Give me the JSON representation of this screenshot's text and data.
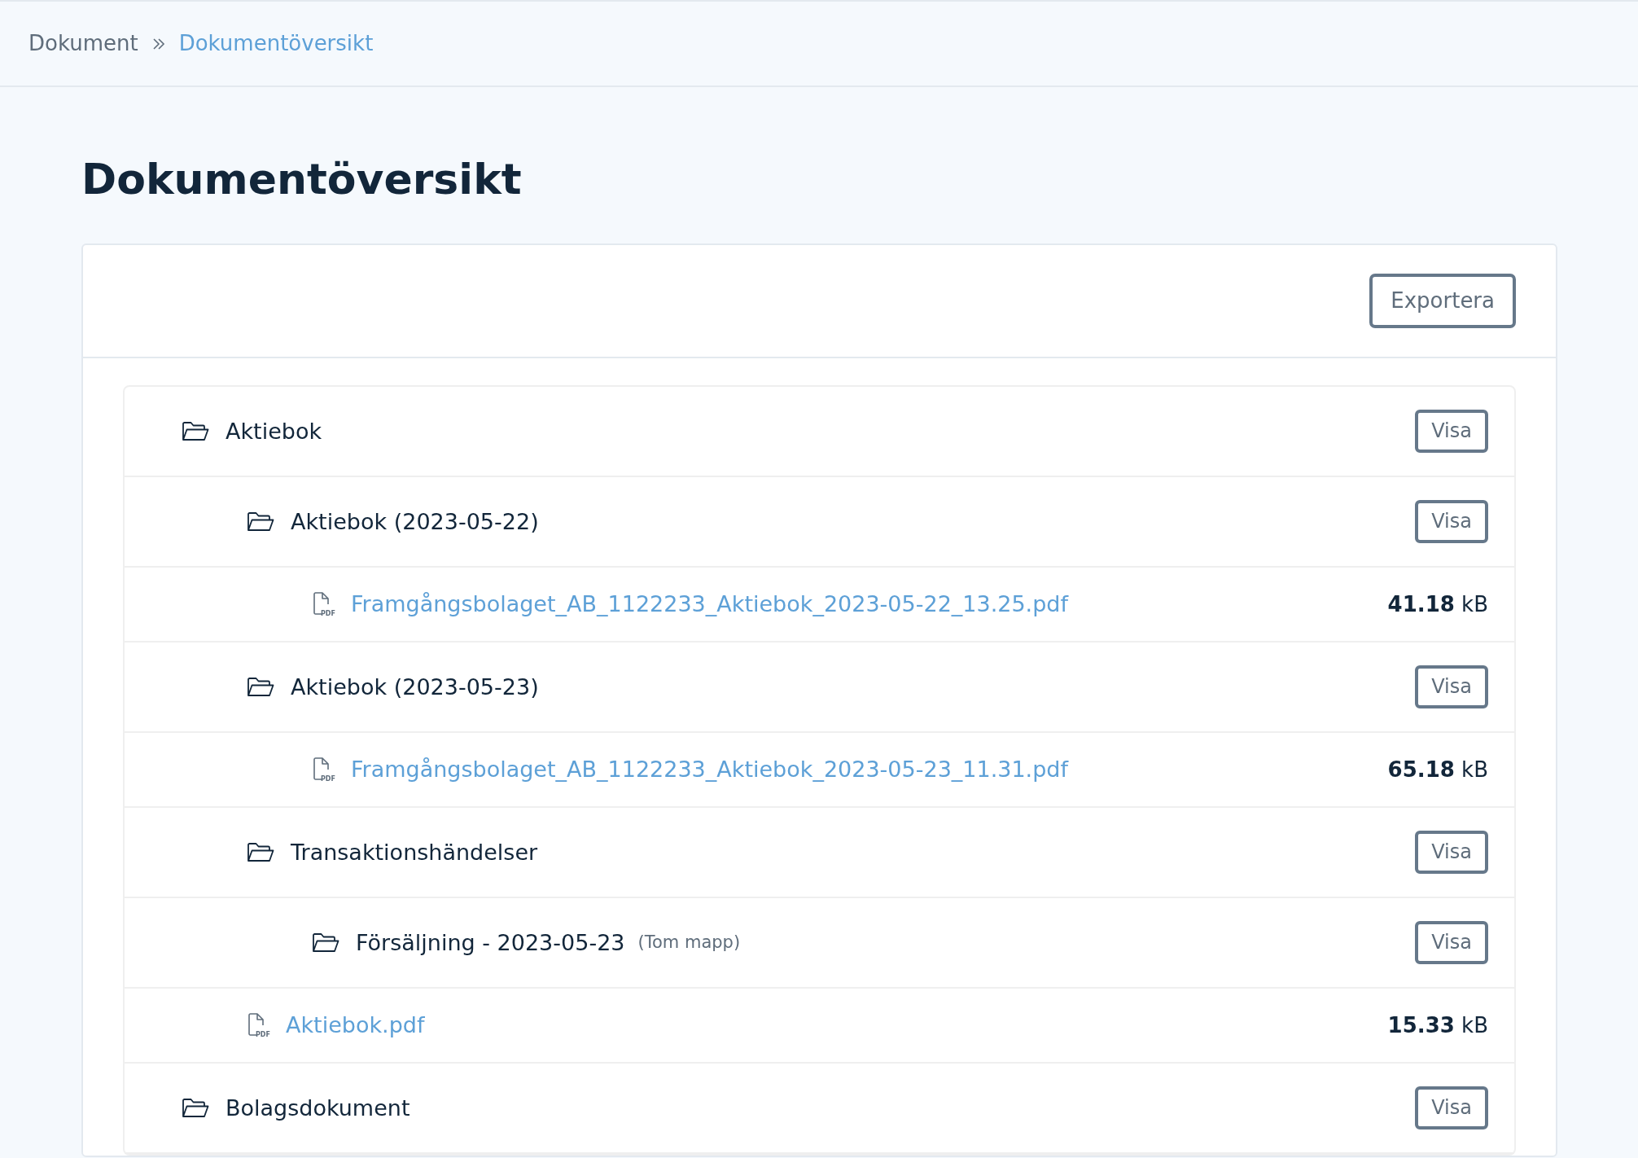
{
  "breadcrumb": [
    {
      "label": "Dokument",
      "selected": false
    },
    {
      "label": "Dokumentöversikt",
      "selected": true
    }
  ],
  "title": "Dokumentöversikt",
  "export_button": "Exportera",
  "tree": [
    {
      "kind": "folder",
      "name": "Aktiebok",
      "action": "Visa",
      "children": [
        {
          "kind": "folder",
          "name": "Aktiebok (2023-05-22)",
          "action": "Visa",
          "children": [
            {
              "kind": "file",
              "icon_label": "PDF",
              "name": "Framgångsbolaget_AB_1122233_Aktiebok_2023-05-22_13.25.pdf",
              "size": "**41.18** kB"
            }
          ]
        },
        {
          "kind": "folder",
          "name": "Aktiebok (2023-05-23)",
          "action": "Visa",
          "children": [
            {
              "kind": "file",
              "icon_label": "PDF",
              "name": "Framgångsbolaget_AB_1122233_Aktiebok_2023-05-23_11.31.pdf",
              "size": "**65.18** kB"
            }
          ]
        },
        {
          "kind": "folder",
          "name": "Transaktionshändelser",
          "action": "Visa",
          "children": [
            {
              "kind": "folder",
              "name": "Försäljning - 2023-05-23",
              "note": "(Tom mapp)",
              "action": "Visa"
            }
          ]
        },
        {
          "kind": "file",
          "icon_label": "PDF",
          "name": "Aktiebok.pdf",
          "size": "**15.33** kB"
        }
      ]
    },
    {
      "kind": "folder",
      "name": "Bolagsdokument",
      "action": "Visa"
    }
  ]
}
